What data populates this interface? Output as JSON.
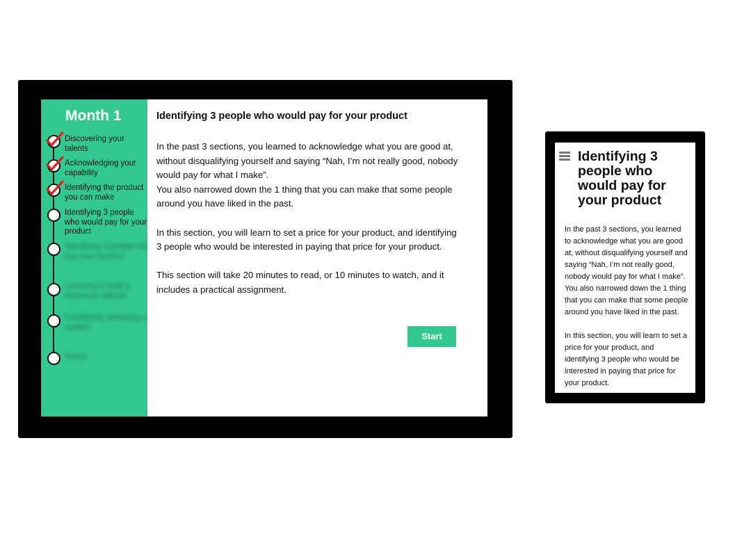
{
  "tablet": {
    "sidebar": {
      "month_title": "Month 1",
      "steps": [
        {
          "label": "Discovering your talents",
          "state": "done"
        },
        {
          "label": "Acknowledging your capability",
          "state": "done"
        },
        {
          "label": "Identifying the product you can make",
          "state": "done"
        },
        {
          "label": "Identifying 3 people who would pay for your product",
          "state": "current"
        },
        {
          "label": "Identifying 3 people will buy your product",
          "state": "locked"
        },
        {
          "label": "Learning to build a showman without",
          "state": "locked"
        },
        {
          "label": "Confidently attacking a market",
          "state": "locked"
        },
        {
          "label": "Select",
          "state": "locked"
        }
      ]
    },
    "main": {
      "title": "Identifying 3 people who would pay for your product",
      "paragraphs": [
        "In the past 3 sections, you learned to acknowledge what you are good at, without disqualifying yourself and saying “Nah, I’m not really good, nobody would pay for what I make”.",
        "You also narrowed down the 1 thing that you can make that some people around you have liked in the past.",
        "In this section, you will learn to set a price for your product, and identifying 3 people who would be interested in paying that price for your product.",
        "This section will take 20 minutes to read, or 10 minutes to watch, and it includes a practical assignment."
      ],
      "start_label": "Start"
    }
  },
  "phone": {
    "menu_icon": "hamburger-menu-icon",
    "title": "Identifying 3 people who would pay for your product",
    "paragraphs": [
      "In the past 3 sections, you learned to acknowledge what you are good at, without disqualifying yourself and saying “Nah, I’m not really good, nobody would pay for what I make”.",
      "You also narrowed down the 1 thing that you can make that some people around you have liked in the past.",
      "In this section, you will learn to set a price for your product, and identifying 3 people who would be interested in paying that price for your product."
    ]
  },
  "colors": {
    "accent": "#33c88f",
    "check": "#e02020",
    "frame": "#000000"
  }
}
